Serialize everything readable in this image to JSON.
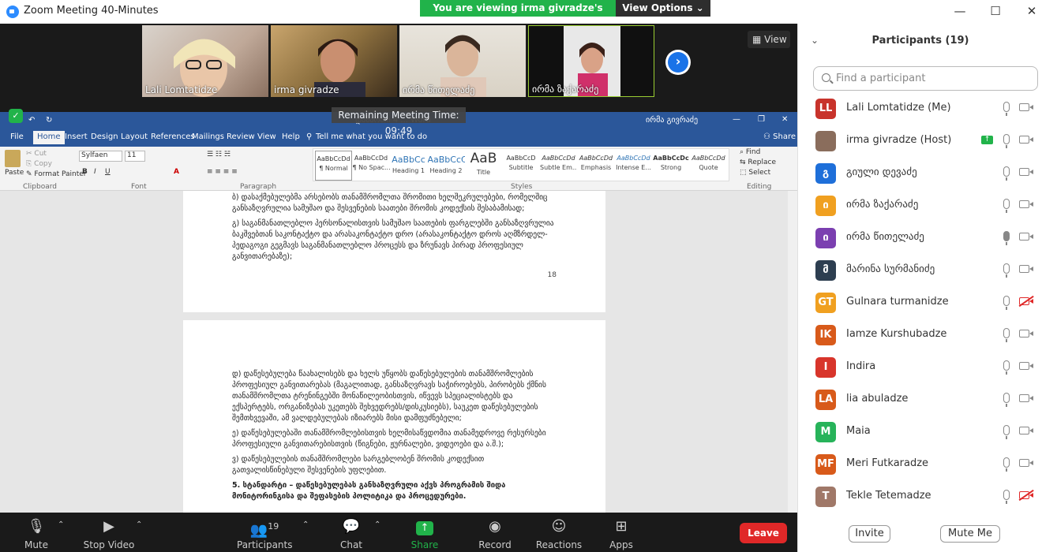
{
  "window": {
    "title": "Zoom Meeting 40-Minutes",
    "minimize": "—",
    "maximize": "☐",
    "close": "✕"
  },
  "banner": {
    "viewing": "You are viewing irma givradze's screen",
    "options": "View Options ⌄"
  },
  "videos": [
    {
      "name": "Lali Lomtatidze"
    },
    {
      "name": "irma givradze"
    },
    {
      "name": "ირმა წითელაძე"
    },
    {
      "name": "ირმა ზაქარაძე"
    }
  ],
  "view_label": "View",
  "remaining": "Remaining Meeting Time: 09:49",
  "word": {
    "window_title": "დანართი 4 ... Word",
    "user": "ირმა გივრაძე",
    "tabs": [
      "File",
      "Home",
      "Insert",
      "Design",
      "Layout",
      "References",
      "Mailings",
      "Review",
      "View",
      "Help"
    ],
    "tell_me": "Tell me what you want to do",
    "share": "Share",
    "clipboard": {
      "paste": "Paste",
      "cut": "Cut",
      "copy": "Copy",
      "format_painter": "Format Painter",
      "group": "Clipboard"
    },
    "font": {
      "name": "Sylfaen",
      "size": "11",
      "group": "Font"
    },
    "paragraph_group": "Paragraph",
    "styles": [
      {
        "preview": "AaBbCcDd",
        "label": "¶ Normal"
      },
      {
        "preview": "AaBbCcDd",
        "label": "¶ No Spac..."
      },
      {
        "preview": "AaBbCc",
        "label": "Heading 1"
      },
      {
        "preview": "AaBbCcC",
        "label": "Heading 2"
      },
      {
        "preview": "AaB",
        "label": "Title"
      },
      {
        "preview": "AaBbCcD",
        "label": "Subtitle"
      },
      {
        "preview": "AaBbCcDd",
        "label": "Subtle Em..."
      },
      {
        "preview": "AaBbCcDd",
        "label": "Emphasis"
      },
      {
        "preview": "AaBbCcDd",
        "label": "Intense E..."
      },
      {
        "preview": "AaBbCcDc",
        "label": "Strong"
      },
      {
        "preview": "AaBbCcDd",
        "label": "Quote"
      }
    ],
    "styles_group": "Styles",
    "editing": {
      "find": "Find",
      "replace": "Replace",
      "select": "Select",
      "group": "Editing"
    },
    "page1": {
      "p1": "ბ) დასაქმებულებმა არსებობს თანამშრომლთა შრომითი ხელშეკრულებები, რომელშიც განსაზღვრულია სამუშაო და შესვენების საათები შრომის კოდექსის შესაბამისად;",
      "p2": "გ) საგანმანათლებლო პერსონალისთვის სამუშაო საათების ფარგლებში განსაზღვრულია ბაკშვებთან საკონტაქტო და არასაკონტაქტო დრო (არასაკონტაქტო დროს აღმზრდელ-პედაგოგი გეგმავს საგანმანათლებლო პროცესს და ზრუნავს პირად პროფესიულ განვითარებაზე);",
      "page_number": "18"
    },
    "page2": {
      "p1": "დ) დაწესებულება წაახალისებს და ხელს უწყობს დაწესებულების თანამშრომლების პროფესიულ განვითარებას (მაგალითად, განსაზღვრავს საჭიროებებს, პირობებს ქმნის თანამშრომლთა ტრენინგებში მონაწილეობისთვის, იწვევს სპეციალისტებს და ექსპერტებს, ორგანიზებას უკეთებს შეხვედრებს/დისკუსიებს), საუკეთ დაწესებულების შემთხვევაში, ამ ვალდებულებას იზიარებს მისი დამფუძნებელი;",
      "p2": "ე) დაწესებულებაში თანამშრომლებისთვის ხელმისაწვდომია თანამედროვე რესურსები პროფესიული განვითარებისთვის (წიგნები, ჟურნალები, ვიდეოები და ა.შ.);",
      "p3": "ვ) დაწესებულების თანამშრომლები სარგებლობენ შრომის კოდექსით გათვალისწინებული შესვენების უფლებით.",
      "p4": "5. სტანდარტი – დაწესებულებას განსაზღვრული აქვს პროგრამის შიდა მონიტორინგისა და შეფასების პოლიტიკა და პროცედურები."
    }
  },
  "toolbar": {
    "mute": "Mute",
    "stop_video": "Stop Video",
    "participants": "Participants",
    "participants_count": "19",
    "chat": "Chat",
    "share_screen": "Share Screen",
    "record": "Record",
    "reactions": "Reactions",
    "apps": "Apps",
    "leave": "Leave"
  },
  "panel": {
    "title": "Participants (19)",
    "search_placeholder": "Find a participant",
    "invite": "Invite",
    "mute_me": "Mute Me",
    "participants": [
      {
        "initials": "LL",
        "color": "#c8332b",
        "name": "Lali Lomtatidze (Me)",
        "video_off": false
      },
      {
        "initials": "",
        "color": "#8a6d5c",
        "name": "irma givradze (Host)",
        "video_off": false,
        "sharing": true
      },
      {
        "initials": "გ",
        "color": "#1e6fd9",
        "name": "გიული დევაძე",
        "video_off": false
      },
      {
        "initials": "ი",
        "color": "#f0a020",
        "name": "ირმა ზაქარაძე",
        "video_off": false
      },
      {
        "initials": "ი",
        "color": "#7b3fb0",
        "name": "ირმა წითელაძე",
        "video_off": false,
        "mic_active": true
      },
      {
        "initials": "მ",
        "color": "#2d3e50",
        "name": "მარინა სურმანიძე",
        "video_off": false
      },
      {
        "initials": "GT",
        "color": "#f0a020",
        "name": "Gulnara turmanidze",
        "video_off": true
      },
      {
        "initials": "IK",
        "color": "#d85a1a",
        "name": "Iamze Kurshubadze",
        "video_off": false
      },
      {
        "initials": "I",
        "color": "#d8352b",
        "name": "Indira",
        "video_off": false
      },
      {
        "initials": "LA",
        "color": "#d85a1a",
        "name": "lia abuladze",
        "video_off": false
      },
      {
        "initials": "M",
        "color": "#27b35a",
        "name": "Maia",
        "video_off": false
      },
      {
        "initials": "MF",
        "color": "#d85a1a",
        "name": "Meri Futkaradze",
        "video_off": false
      },
      {
        "initials": "T",
        "color": "#a07868",
        "name": "Tekle Tetemadze",
        "video_off": true
      }
    ]
  }
}
